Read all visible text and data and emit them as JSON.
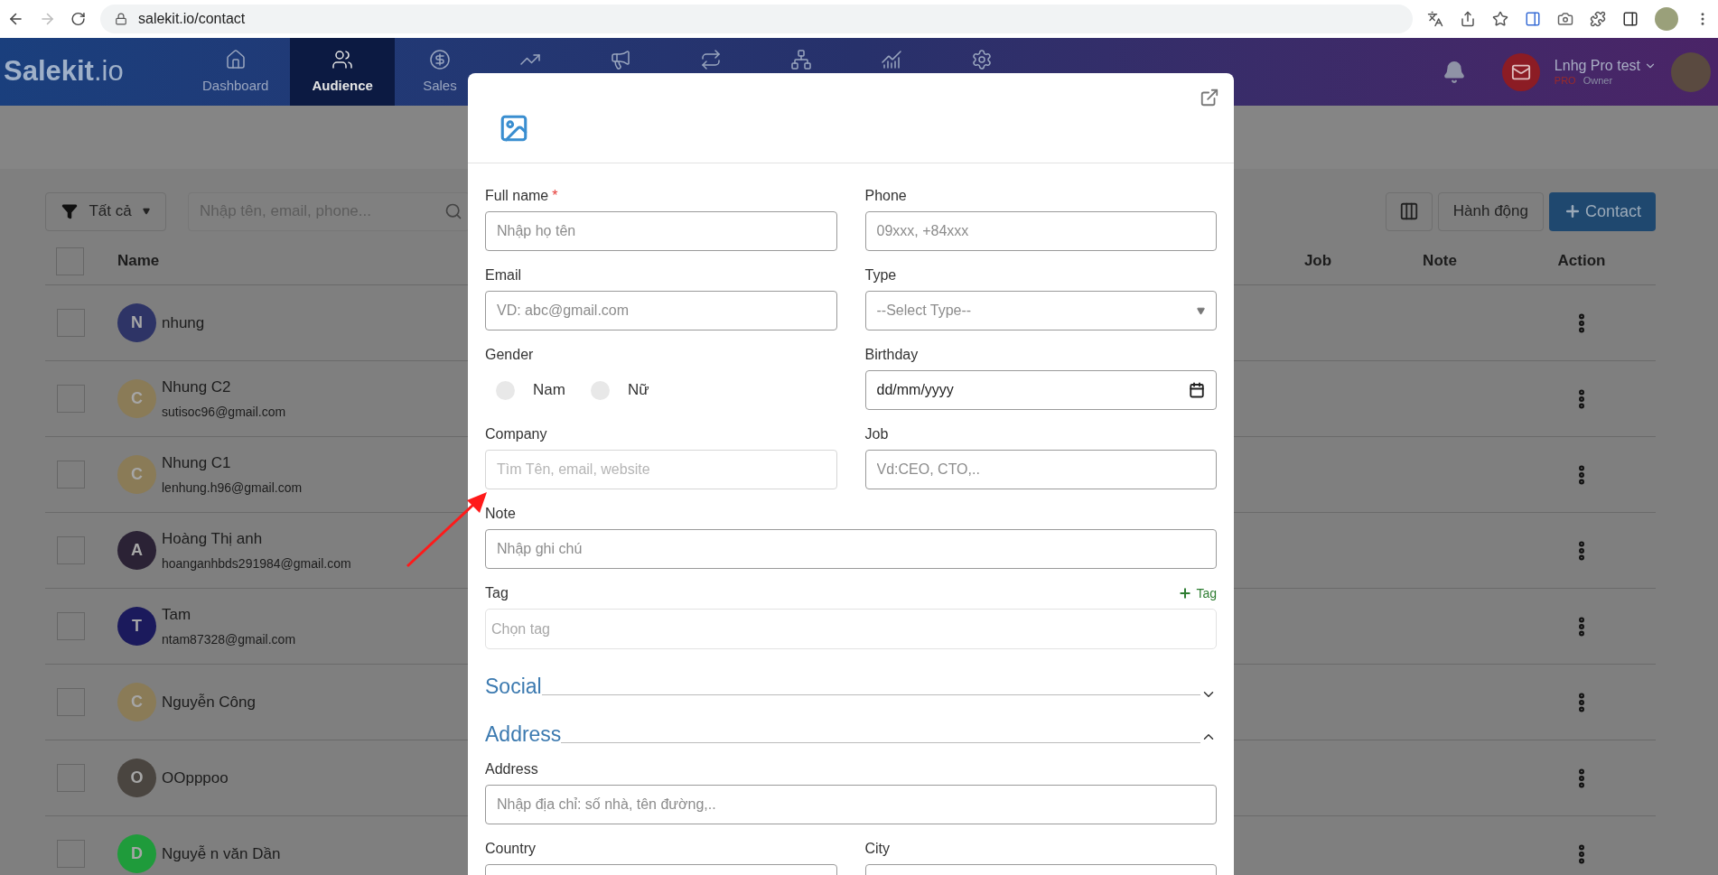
{
  "browser": {
    "url": "salekit.io/contact",
    "forward_disabled": true
  },
  "nav": {
    "logo": {
      "name": "Salekit",
      "suffix": ".io"
    },
    "items": [
      {
        "kind": "home",
        "label": "Dashboard",
        "selected": false
      },
      {
        "kind": "users",
        "label": "Audience",
        "selected": true
      },
      {
        "kind": "dollar",
        "label": "Sales",
        "selected": false
      },
      {
        "kind": "trend",
        "selected": false
      },
      {
        "kind": "megaphone",
        "selected": false
      },
      {
        "kind": "repeat",
        "selected": false
      },
      {
        "kind": "network",
        "selected": false
      },
      {
        "kind": "bars",
        "selected": false
      },
      {
        "kind": "settings",
        "selected": false
      }
    ],
    "user": {
      "name": "Lnhg Pro test",
      "plan": "PRO",
      "role": "Owner"
    }
  },
  "toolbar": {
    "filter": "Tất cả",
    "search_placeholder": "Nhập tên, email, phone...",
    "action_button": "Hành động",
    "add_button": "Contact"
  },
  "table": {
    "select_all_checked": false,
    "columns": [
      "Name",
      "Job",
      "Note",
      "Action"
    ],
    "rows": [
      {
        "initial": "N",
        "color": "#2e3466",
        "name": "nhung",
        "checked": false
      },
      {
        "initial": "C",
        "color": "#8a7b57",
        "name": "Nhung C2",
        "email": "sutisoc96@gmail.com",
        "checked": false
      },
      {
        "initial": "C",
        "color": "#8a7b57",
        "name": "Nhung C1",
        "email": "lenhung.h96@gmail.com",
        "checked": false
      },
      {
        "initial": "A",
        "color": "#2b2235",
        "name": "Hoàng Thị anh",
        "email": "hoanganhbds291984@gmail.com",
        "checked": false
      },
      {
        "initial": "T",
        "color": "#1b1a5c",
        "name": "Tam",
        "email": "ntam87328@gmail.com",
        "checked": false
      },
      {
        "initial": "C",
        "color": "#8a7b57",
        "name": "Nguyễn Công",
        "checked": false
      },
      {
        "initial": "O",
        "color": "#4a4540",
        "name": "OOpppoo",
        "checked": false
      },
      {
        "initial": "D",
        "color": "#1f9b3b",
        "name": "Nguyễ n văn Dần",
        "checked": false
      }
    ]
  },
  "modal": {
    "items": [
      {
        "kind": "row",
        "fields": [
          {
            "kind": "text",
            "label": "Full name",
            "required_mark": "*",
            "placeholder": "Nhập họ tên"
          },
          {
            "kind": "text",
            "label": "Phone",
            "placeholder": "09xxx, +84xxx"
          }
        ]
      },
      {
        "kind": "row",
        "fields": [
          {
            "kind": "text",
            "label": "Email",
            "placeholder": "VD: abc@gmail.com"
          },
          {
            "kind": "select",
            "label": "Type",
            "value": "--Select Type--"
          }
        ]
      },
      {
        "kind": "row",
        "fields": [
          {
            "kind": "radio",
            "label": "Gender",
            "options": [
              {
                "label": "Nam",
                "selected": false
              },
              {
                "label": "Nữ",
                "selected": false
              }
            ]
          },
          {
            "kind": "date",
            "label": "Birthday",
            "value": "dd/mm/yyyy"
          }
        ]
      },
      {
        "kind": "row",
        "fields": [
          {
            "kind": "lookup",
            "label": "Company",
            "placeholder": "Tìm Tên, email, website"
          },
          {
            "kind": "text",
            "label": "Job",
            "placeholder": "Vd:CEO, CTO,.."
          }
        ]
      },
      {
        "kind": "row",
        "fields": [
          {
            "kind": "text",
            "label": "Note",
            "placeholder": "Nhập ghi chú"
          }
        ]
      },
      {
        "kind": "row",
        "fields": [
          {
            "kind": "tag",
            "label": "Tag",
            "action": "Tag",
            "placeholder": "Chọn tag"
          }
        ]
      },
      {
        "kind": "section",
        "title": "Social",
        "expanded": false
      },
      {
        "kind": "section",
        "title": "Address",
        "expanded": true
      },
      {
        "kind": "row",
        "fields": [
          {
            "kind": "text",
            "label": "Address",
            "placeholder": "Nhập địa chỉ: số nhà, tên đường,.."
          }
        ]
      },
      {
        "kind": "row",
        "fields": [
          {
            "kind": "text",
            "label": "Country"
          },
          {
            "kind": "text",
            "label": "City"
          }
        ]
      }
    ]
  }
}
